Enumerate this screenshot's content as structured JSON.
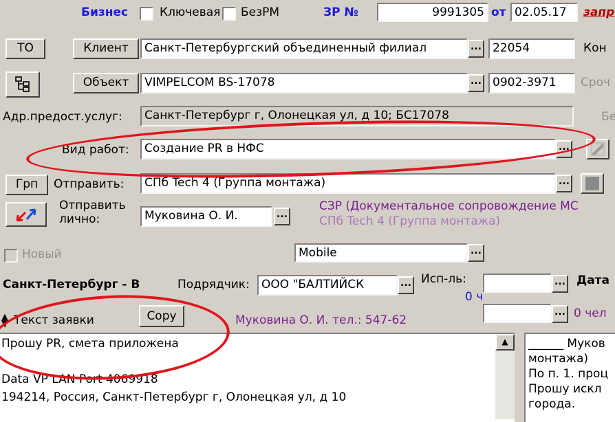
{
  "top": {
    "biznes": "Бизнес",
    "kluchevaya": "Ключевая",
    "bezrm": "БезРМ",
    "zr_label": "ЗР №",
    "zr_number": "9991305",
    "ot": "от",
    "date": "02.05.17",
    "zapr": "запр"
  },
  "row_client": {
    "to_btn": "ТО",
    "client_btn": "Клиент",
    "client_value": "Санкт-Петербургский объединенный филиал",
    "code": "22054",
    "kon": "Кон"
  },
  "row_object": {
    "object_btn": "Объект",
    "object_value": "VIMPELCOM BS-17078",
    "code": "0902-3971",
    "srochn": "Сроч"
  },
  "row_address": {
    "label": "Адр.предост.услуг:",
    "value": "Санкт-Петербург г, Олонецкая ул, д 10; БС17078",
    "be": "Бе"
  },
  "row_work": {
    "label": "Вид работ:",
    "value": "Создание PR в НФС"
  },
  "row_send": {
    "grp_btn": "Грп",
    "label": "Отправить:",
    "value": "СПб Tech 4   (Группа монтажа)"
  },
  "row_send_personal": {
    "label_line1": "Отправить",
    "label_line2": "лично:",
    "value": "Муковина О. И.",
    "info_line1": "СЗР (Документальное сопровождение МС",
    "info_line2": "СПб Tech 4   (Группа монтажа)"
  },
  "row_new": {
    "label": "Новый",
    "mobile": "Mobile"
  },
  "row_contractor": {
    "region": "Санкт-Петербург - В",
    "label": "Подрядчик:",
    "value": "ООО \"БАЛТИЙСК",
    "isp_label": "Исп-ль:",
    "hours": "0 ч",
    "date_label": "Дата",
    "people": "0 чел"
  },
  "row_text": {
    "label": "Текст заявки",
    "copy_btn": "Copy",
    "contact": "Муковина О. И. тел.: 547-62"
  },
  "text_area": {
    "line1": "Прошу PR, смета приложена",
    "line2": "Data VP LAN Port 4069918",
    "line3": "194214, Россия, Санкт-Петербург г, Олонецкая ул, д 10"
  },
  "right_panel": {
    "line1": "______ Муков",
    "line2": "монтажа)",
    "line3": "По п. 1. проц",
    "line4": "Прошу искл",
    "line5": "города."
  },
  "colors": {
    "window_bg": "#d4d0c8",
    "annotation": "#e0141c",
    "accent_blue": "#1b1bd6",
    "accent_purple": "#7a1f8f"
  }
}
